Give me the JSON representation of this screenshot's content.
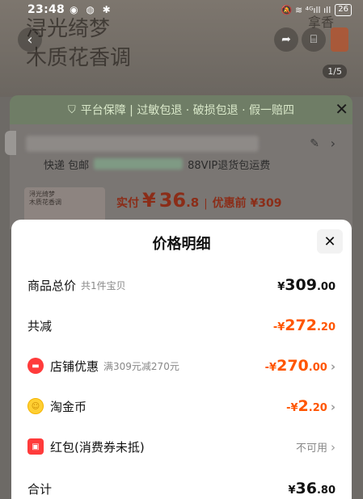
{
  "status_bar": {
    "time": "23:48",
    "left_icons": "◉ ◍ ✱",
    "right_icons": "🔕 ≋ ⁴ᴳıll ıll",
    "battery": "26"
  },
  "product": {
    "hero_line1": "浔光绮梦",
    "hero_line2": "木质花香调",
    "hero_side": "拿香",
    "page_counter": "1/5",
    "thumb_line1": "浔光绮梦",
    "thumb_line2": "木质花香调"
  },
  "guarantee_bar": {
    "text": "平台保障 | 过敏包退 · 破损包退 · 假一赔四"
  },
  "shipping": {
    "label": "快递 包邮",
    "vip": "88VIP退货包运费"
  },
  "pay_summary": {
    "label": "实付",
    "currency": "¥",
    "amount_int": "36",
    "amount_dec": ".8",
    "sep": "|",
    "before_label": "优惠前 ¥309"
  },
  "sheet": {
    "title": "价格明细",
    "rows": [
      {
        "label": "商品总价",
        "sub": "共1件宝贝",
        "prefix": "¥",
        "int": "309",
        "dec": ".00"
      },
      {
        "label": "共减",
        "sub": "",
        "prefix": "-¥",
        "int": "272",
        "dec": ".20"
      },
      {
        "label": "店铺优惠",
        "sub": "满309元减270元",
        "prefix": "-¥",
        "int": "270",
        "dec": ".00"
      },
      {
        "label": "淘金币",
        "sub": "",
        "prefix": "-¥",
        "int": "2",
        "dec": ".20"
      },
      {
        "label": "红包(消费券未抵)",
        "sub": "",
        "value": "不可用"
      },
      {
        "label": "合计",
        "sub": "",
        "prefix": "¥",
        "int": "36",
        "dec": ".80"
      }
    ]
  },
  "colors": {
    "accent_orange": "#ff5500",
    "shop_icon_red": "#ff3b3b",
    "coin_yellow": "#ffcf33"
  },
  "icons": [
    "back-icon",
    "share-icon",
    "cart-icon",
    "shield-icon",
    "close-icon",
    "edit-icon",
    "chevron-right-icon",
    "shop-icon",
    "coin-icon",
    "red-packet-icon"
  ]
}
